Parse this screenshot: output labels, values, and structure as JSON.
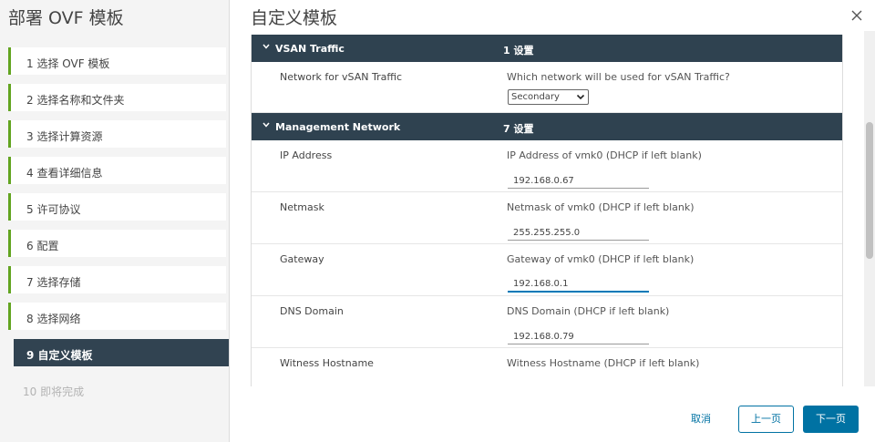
{
  "wizard": {
    "title": "部署 OVF 模板",
    "steps": [
      {
        "label": "1  选择 OVF 模板",
        "state": "done"
      },
      {
        "label": "2  选择名称和文件夹",
        "state": "done"
      },
      {
        "label": "3  选择计算资源",
        "state": "done"
      },
      {
        "label": "4  查看详细信息",
        "state": "done"
      },
      {
        "label": "5  许可协议",
        "state": "done"
      },
      {
        "label": "6  配置",
        "state": "done"
      },
      {
        "label": "7  选择存储",
        "state": "done"
      },
      {
        "label": "8  选择网络",
        "state": "done"
      },
      {
        "label": "9  自定义模板",
        "state": "active"
      },
      {
        "label": "10  即将完成",
        "state": "disabled"
      }
    ]
  },
  "main": {
    "title": "自定义模板",
    "sections": [
      {
        "name": "VSAN Traffic",
        "count": "1 设置",
        "rows": [
          {
            "label": "Network for vSAN Traffic",
            "description": "Which network will be used for vSAN Traffic?",
            "select_value": "Secondary"
          }
        ]
      },
      {
        "name": "Management Network",
        "count": "7 设置",
        "rows": [
          {
            "label": "IP Address",
            "description": "IP Address of vmk0 (DHCP if left blank)",
            "value": "192.168.0.67"
          },
          {
            "label": "Netmask",
            "description": "Netmask of vmk0 (DHCP if left blank)",
            "value": "255.255.255.0"
          },
          {
            "label": "Gateway",
            "description": "Gateway of vmk0 (DHCP if left blank)",
            "value": "192.168.0.1"
          },
          {
            "label": "DNS Domain",
            "description": "DNS Domain (DHCP if left blank)",
            "value": "192.168.0.79"
          },
          {
            "label": "Witness Hostname",
            "description": "Witness Hostname (DHCP if left blank)",
            "value": ""
          }
        ]
      }
    ]
  },
  "footer": {
    "cancel": "取消",
    "back": "上一页",
    "next": "下一页"
  },
  "colors": {
    "accent": "#0072a3",
    "step_done": "#62a420",
    "header_dark": "#2f4250"
  }
}
